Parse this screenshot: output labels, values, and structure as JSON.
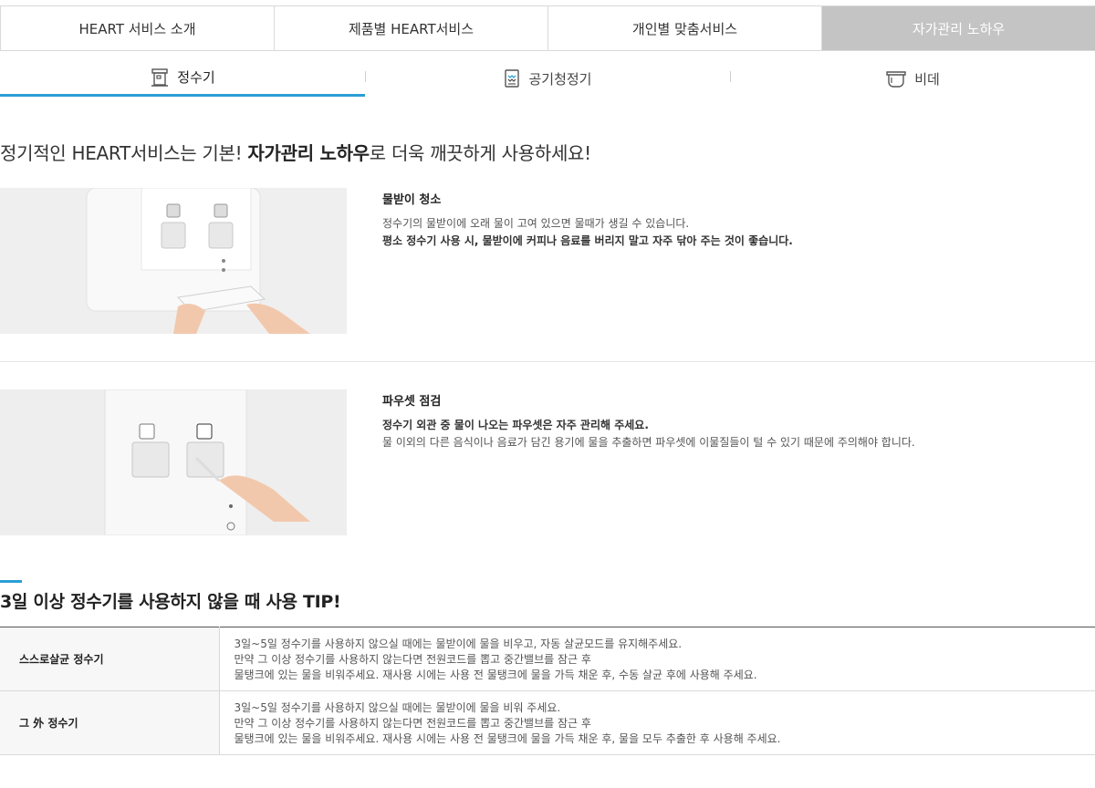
{
  "top_tabs": [
    {
      "label": "HEART 서비스 소개"
    },
    {
      "label": "제품별 HEART서비스"
    },
    {
      "label": "개인별 맞춤서비스"
    },
    {
      "label": "자가관리 노하우"
    }
  ],
  "sub_tabs": [
    {
      "label": "정수기",
      "icon": "water-purifier-icon"
    },
    {
      "label": "공기청정기",
      "icon": "air-purifier-icon"
    },
    {
      "label": "비데",
      "icon": "bidet-icon"
    }
  ],
  "headline": {
    "prefix": "정기적인 HEART서비스는 기본! ",
    "bold": "자가관리 노하우",
    "suffix": "로 더욱 깨끗하게 사용하세요!"
  },
  "care_items": [
    {
      "title": "물받이 청소",
      "line1": "정수기의 물받이에 오래 물이 고여 있으면 물때가 생길 수 있습니다.",
      "line2": "평소 정수기 사용 시, 물받이에 커피나 음료를 버리지 말고 자주 닦아 주는 것이 좋습니다."
    },
    {
      "title": "파우셋 점검",
      "line1": "정수기 외관 중 물이 나오는 파우셋은 자주 관리해 주세요.",
      "line2": "물 이외의 다른 음식이나 음료가 담긴 용기에 물을 추출하면 파우셋에 이물질들이 털 수 있기 때문에 주의해야 합니다."
    }
  ],
  "tip": {
    "title": "3일 이상 정수기를 사용하지 않을 때 사용 TIP!",
    "rows": [
      {
        "label": "스스로살균 정수기",
        "lines": [
          "3일~5일 정수기를 사용하지 않으실 때에는 물받이에 물을 비우고, 자동 살균모드를 유지해주세요.",
          "만약 그 이상 정수기를 사용하지 않는다면 전원코드를 뽑고 중간밸브를 잠근 후",
          "물탱크에 있는 물을 비워주세요. 재사용 시에는 사용 전 물탱크에 물을 가득 채운 후, 수동 살균 후에 사용해 주세요."
        ]
      },
      {
        "label": "그 外 정수기",
        "lines": [
          "3일~5일 정수기를 사용하지 않으실 때에는 물받이에 물을 비워 주세요.",
          "만약 그 이상 정수기를 사용하지 않는다면 전원코드를 뽑고 중간밸브를 잠근 후",
          "물탱크에 있는 물을 비워주세요. 재사용 시에는 사용 전 물탱크에 물을 가득 채운 후, 물을 모두 추출한 후 사용해 주세요."
        ]
      }
    ]
  },
  "colors": {
    "accent": "#2a9fd6",
    "active_tab_bg": "#c4c4c4"
  }
}
